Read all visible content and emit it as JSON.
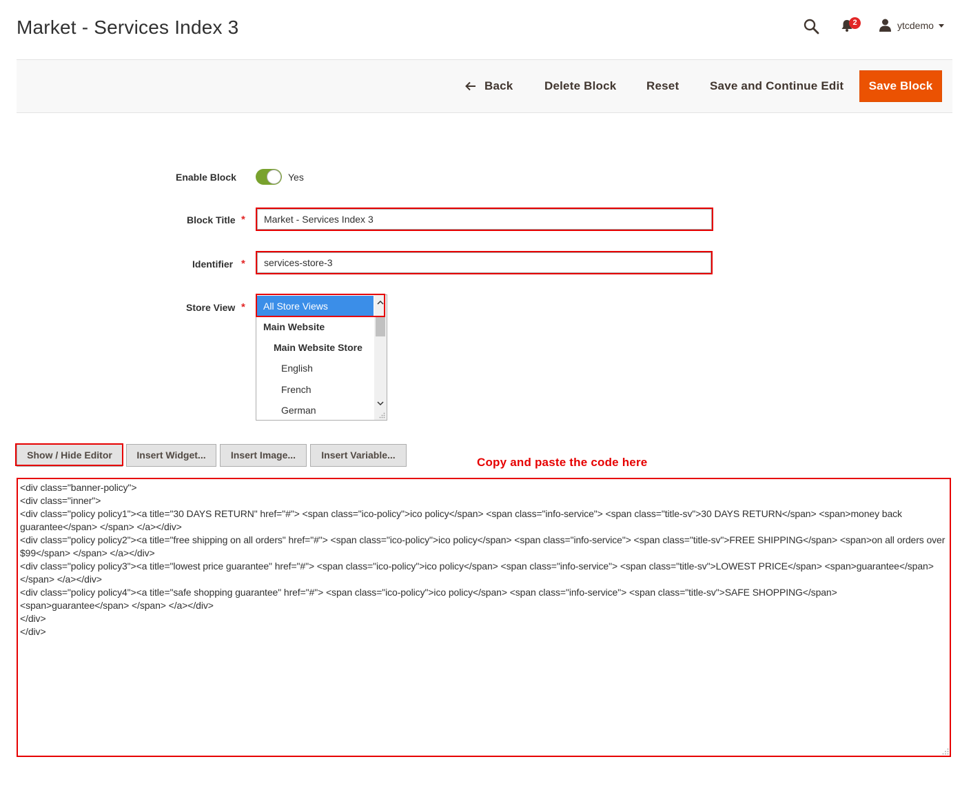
{
  "header": {
    "page_title": "Market - Services Index 3",
    "notifications_count": "2",
    "user_name": "ytcdemo"
  },
  "toolbar": {
    "back_label": "Back",
    "delete_label": "Delete Block",
    "reset_label": "Reset",
    "save_continue_label": "Save and Continue Edit",
    "save_label": "Save Block"
  },
  "form": {
    "enable_block": {
      "label": "Enable Block",
      "value": "Yes",
      "enabled": true
    },
    "block_title": {
      "label": "Block Title",
      "value": "Market - Services Index 3"
    },
    "identifier": {
      "label": "Identifier",
      "value": "services-store-3"
    },
    "store_view": {
      "label": "Store View",
      "options": [
        "All Store Views",
        "Main Website",
        "Main Website Store",
        "English",
        "French",
        "German"
      ],
      "selected": "All Store Views"
    }
  },
  "editor": {
    "show_hide_label": "Show / Hide Editor",
    "insert_widget_label": "Insert Widget...",
    "insert_image_label": "Insert Image...",
    "insert_variable_label": "Insert Variable...",
    "annotation": "Copy and paste the code here",
    "content": "<div class=\"banner-policy\">\n<div class=\"inner\">\n<div class=\"policy policy1\"><a title=\"30 DAYS RETURN\" href=\"#\"> <span class=\"ico-policy\">ico policy</span> <span class=\"info-service\"> <span class=\"title-sv\">30 DAYS RETURN</span> <span>money back guarantee</span> </span> </a></div>\n<div class=\"policy policy2\"><a title=\"free shipping on all orders\" href=\"#\"> <span class=\"ico-policy\">ico policy</span> <span class=\"info-service\"> <span class=\"title-sv\">FREE SHIPPING</span> <span>on all orders over $99</span> </span> </a></div>\n<div class=\"policy policy3\"><a title=\"lowest price guarantee\" href=\"#\"> <span class=\"ico-policy\">ico policy</span> <span class=\"info-service\"> <span class=\"title-sv\">LOWEST PRICE</span> <span>guarantee</span> </span> </a></div>\n<div class=\"policy policy4\"><a title=\"safe shopping guarantee\" href=\"#\"> <span class=\"ico-policy\">ico policy</span> <span class=\"info-service\"> <span class=\"title-sv\">SAFE SHOPPING</span> <span>guarantee</span> </span> </a></div>\n</div>\n</div>"
  },
  "colors": {
    "accent": "#eb5202",
    "toggle_on": "#79a22e",
    "highlight_frame": "#e60000",
    "selected_option": "#3b8ee8"
  },
  "icons": [
    "search-icon",
    "bell-icon",
    "user-icon",
    "arrow-left-icon",
    "caret-down-icon"
  ]
}
